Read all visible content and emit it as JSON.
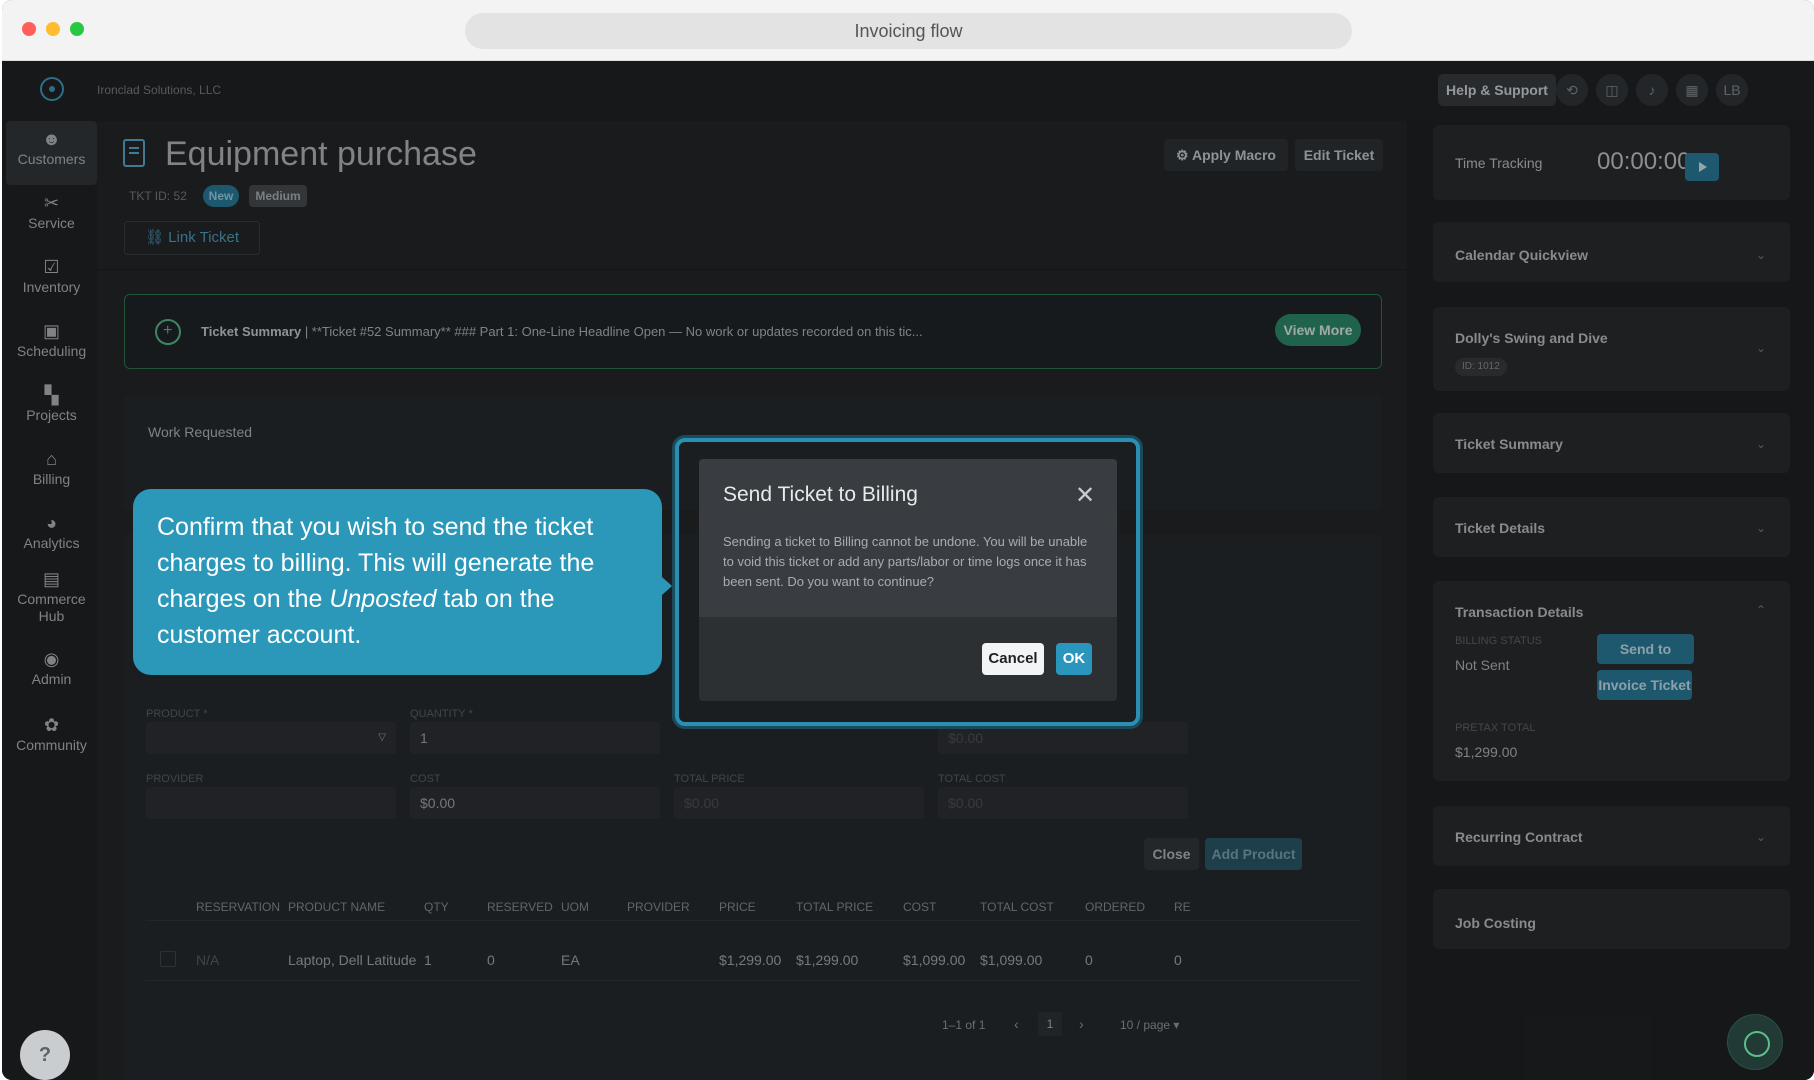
{
  "browser": {
    "title": "Invoicing flow"
  },
  "appbar": {
    "company": "Ironclad Solutions, LLC",
    "help_label": "Help & Support",
    "avatar_initials": "LB"
  },
  "sidebar": {
    "items": [
      {
        "label": "Customers",
        "icon": "customers-icon"
      },
      {
        "label": "Service",
        "icon": "service-icon"
      },
      {
        "label": "Inventory",
        "icon": "inventory-icon"
      },
      {
        "label": "Scheduling",
        "icon": "calendar-icon"
      },
      {
        "label": "Projects",
        "icon": "projects-icon"
      },
      {
        "label": "Billing",
        "icon": "bank-icon"
      },
      {
        "label": "Analytics",
        "icon": "pie-chart-icon"
      },
      {
        "label": "Commerce Hub",
        "icon": "store-icon"
      },
      {
        "label": "Admin",
        "icon": "admin-icon"
      },
      {
        "label": "Community",
        "icon": "community-icon"
      }
    ],
    "help_glyph": "?"
  },
  "ticket": {
    "title": "Equipment purchase",
    "id_label": "TKT ID: 52",
    "status_badge": "New",
    "priority_badge": "Medium",
    "link_ticket": "Link Ticket",
    "apply_macro": "Apply Macro",
    "edit_ticket": "Edit Ticket"
  },
  "summary": {
    "label": "Ticket Summary",
    "text": " | **Ticket #52 Summary** ### Part 1: One-Line Headline Open — No work or updates recorded on this tic...",
    "view_more": "View More"
  },
  "work": {
    "label": "Work Requested"
  },
  "product_form": {
    "product_label": "PRODUCT *",
    "quantity_label": "QUANTITY *",
    "quantity_value": "1",
    "total_cost_top": "$0.00",
    "provider_label": "PROVIDER",
    "cost_label": "COST",
    "cost_value": "$0.00",
    "total_price_label": "TOTAL PRICE",
    "total_price_value": "$0.00",
    "total_cost_label": "TOTAL COST",
    "total_cost_value": "$0.00",
    "close": "Close",
    "add_product": "Add Product"
  },
  "table": {
    "headers": [
      "RESERVATION",
      "PRODUCT NAME",
      "QTY",
      "RESERVED",
      "UOM",
      "PROVIDER",
      "PRICE",
      "TOTAL PRICE",
      "COST",
      "TOTAL COST",
      "ORDERED",
      "RE"
    ],
    "row": [
      "N/A",
      "Laptop, Dell Latitude",
      "1",
      "0",
      "EA",
      "",
      "$1,299.00",
      "$1,299.00",
      "$1,099.00",
      "$1,099.00",
      "0",
      "0"
    ],
    "pagination_range": "1–1 of 1",
    "current_page": "1",
    "per_page": "10 / page"
  },
  "right": {
    "time_tracking_label": "Time Tracking",
    "time_value": "00:00:00",
    "calendar": "Calendar Quickview",
    "customer_name": "Dolly's Swing and Dive",
    "customer_id": "ID: 1012",
    "ticket_summary": "Ticket Summary",
    "ticket_details": "Ticket Details",
    "transaction_details": "Transaction Details",
    "billing_status_label": "BILLING STATUS",
    "billing_status_value": "Not Sent",
    "send_to_billing": "Send to Billing",
    "invoice_ticket": "Invoice Ticket",
    "pretax_label": "PRETAX TOTAL",
    "pretax_value": "$1,299.00",
    "recurring": "Recurring Contract",
    "job_costing": "Job Costing"
  },
  "tooltip": {
    "text_before": "Confirm that you wish to send the ticket charges to billing. This will generate the charges on the ",
    "text_italic": "Unposted",
    "text_after": " tab on the customer account."
  },
  "modal": {
    "title": "Send Ticket to Billing",
    "body": "Sending a ticket to Billing cannot be undone. You will be unable to void this ticket or add any parts/labor or time logs once it has been sent. Do you want to continue?",
    "cancel": "Cancel",
    "ok": "OK"
  },
  "colors": {
    "accent": "#2a95bd",
    "tooltip_bg": "#2b98b9",
    "summary_border": "#2f7a55",
    "view_more_bg": "#2f8f6f"
  }
}
